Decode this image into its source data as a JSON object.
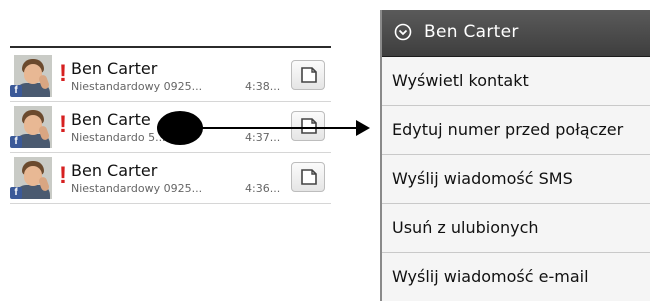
{
  "call_log": {
    "entries": [
      {
        "name": "Ben Carter",
        "number": "Niestandardowy 0925...",
        "time": "4:38...",
        "badge": "f"
      },
      {
        "name": "Ben Carte",
        "number": "Niestandardo  5...",
        "time": "4:37...",
        "badge": "f"
      },
      {
        "name": "Ben Carter",
        "number": "Niestandardowy 0925...",
        "time": "4:36...",
        "badge": "f"
      }
    ],
    "missed_indicator": "!"
  },
  "context_menu": {
    "title": "Ben Carter",
    "items": [
      {
        "label": "Wyświetl kontakt"
      },
      {
        "label": "Edytuj numer przed połączer"
      },
      {
        "label": "Wyślij wiadomość SMS"
      },
      {
        "label": "Usuń z ulubionych"
      },
      {
        "label": "Wyślij wiadomość e-mail"
      }
    ]
  },
  "colors": {
    "missed": "#d62020",
    "facebook": "#3b5998",
    "menu_header": "#4a4a4a"
  },
  "icons": {
    "sms_button": "sms-compose-icon",
    "menu_header": "chevron-down-circle-icon"
  }
}
